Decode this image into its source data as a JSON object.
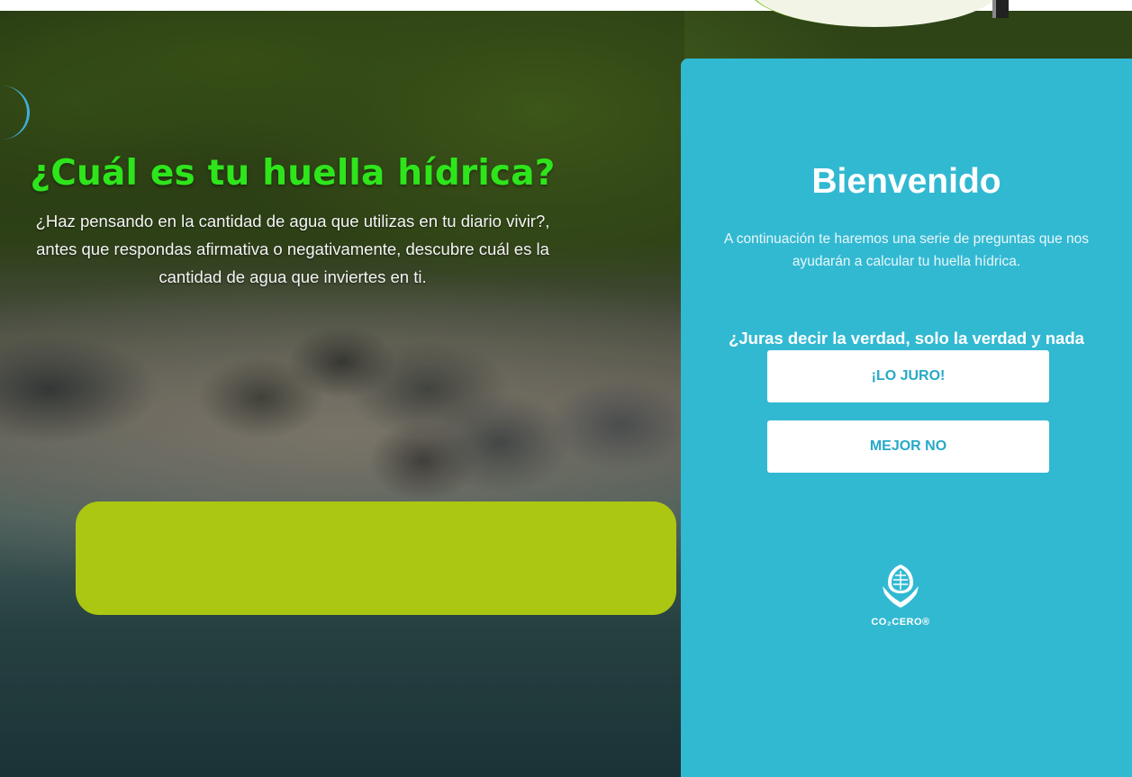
{
  "hero": {
    "title": "¿Cuál es tu huella hídrica?",
    "description": "¿Haz pensando en la cantidad de agua que utilizas en tu diario vivir?, antes que respondas afirmativa o negativamente, descubre cuál es la cantidad de agua que inviertes en ti."
  },
  "card": {
    "title": "Bienvenido",
    "intro": "A continuación te haremos una serie de preguntas que nos ayudarán a calcular tu huella hídrica.",
    "question": "¿Juras decir la verdad, solo la verdad y nada más que la verdad?",
    "accept_label": "¡LO JURO!",
    "decline_label": "MEJOR NO"
  },
  "logo": {
    "text": "CO₂CERO®",
    "icon": "hands-holding-leaf-icon"
  },
  "colors": {
    "title_green": "#2ee51c",
    "card_blue": "#32b9d2",
    "button_text": "#27a9c8",
    "panel_green": "#abc711"
  }
}
